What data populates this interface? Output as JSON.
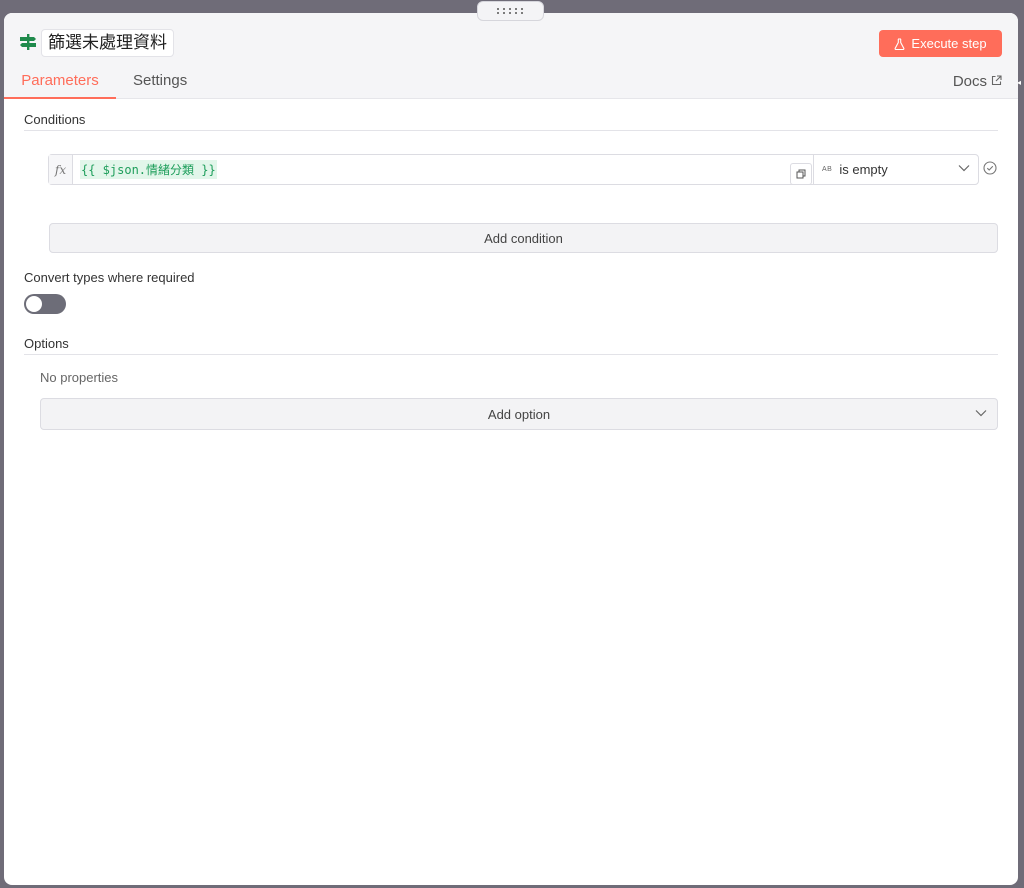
{
  "node": {
    "title": "篩選未處理資料",
    "icon": "signpost-icon"
  },
  "header": {
    "execute_label": "Execute step",
    "execute_icon": "flask-icon",
    "tabs": [
      {
        "label": "Parameters",
        "active": true
      },
      {
        "label": "Settings",
        "active": false
      }
    ],
    "docs_label": "Docs",
    "docs_icon": "external-link-icon"
  },
  "conditions": {
    "label": "Conditions",
    "rows": [
      {
        "expression": "{{ $json.情緒分類 }}",
        "operator": "is empty",
        "operator_type_badge": "AB"
      }
    ],
    "add_label": "Add condition"
  },
  "convert_types": {
    "label": "Convert types where required",
    "enabled": false
  },
  "options": {
    "label": "Options",
    "empty_text": "No properties",
    "add_label": "Add option"
  },
  "colors": {
    "accent": "#ff6d5a",
    "expression_green": "#1e9e5b",
    "node_icon": "#1f8a4c"
  }
}
